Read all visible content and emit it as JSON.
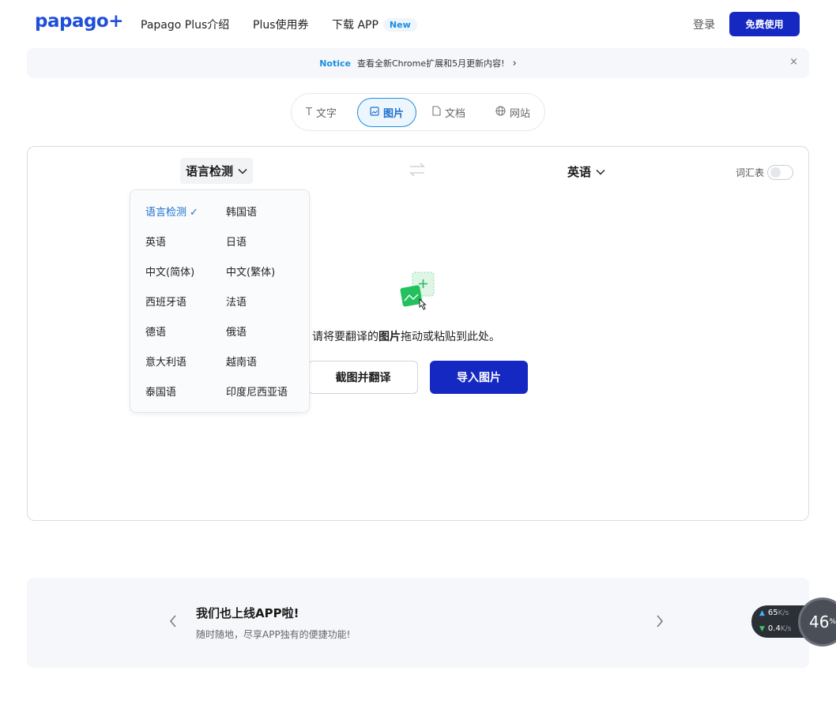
{
  "header": {
    "logo": "papago",
    "logo_plus": "+",
    "nav": [
      "Papago Plus介绍",
      "Plus使用券",
      "下载 APP"
    ],
    "new_badge": "New",
    "login": "登录",
    "free_use": "免费使用"
  },
  "notice": {
    "label": "Notice",
    "text": "查看全新Chrome扩展和5月更新内容!",
    "chevron": "›",
    "close": "×"
  },
  "tabs": {
    "text": "文字",
    "image": "图片",
    "document": "文档",
    "website": "网站",
    "active": "image"
  },
  "translator": {
    "source_lang": "语言检测",
    "target_lang": "英语",
    "vocab_label": "词汇表",
    "drop_text_before": "请将要翻译的",
    "drop_text_bold": "图片",
    "drop_text_after": "拖动或粘贴到此处。",
    "capture_button": "截图并翻译",
    "import_button": "导入图片"
  },
  "dropdown": {
    "selected": "语言检测",
    "options_left": [
      "语言检测",
      "英语",
      "中文(简体)",
      "西班牙语",
      "德语",
      "意大利语",
      "泰国语"
    ],
    "options_right": [
      "韩国语",
      "日语",
      "中文(繁体)",
      "法语",
      "俄语",
      "越南语",
      "印度尼西亚语"
    ]
  },
  "banner": {
    "title": "我们也上线APP啦!",
    "subtitle": "随时随地，尽享APP独有的便捷功能!"
  },
  "speed_widget": {
    "upload": "65",
    "download": "0.4",
    "unit": "K/s",
    "percent": "46",
    "percent_sign": "%"
  },
  "colors": {
    "brand": "#1529c2",
    "accent": "#1a6fd0",
    "logo": "#1e4fd8"
  }
}
